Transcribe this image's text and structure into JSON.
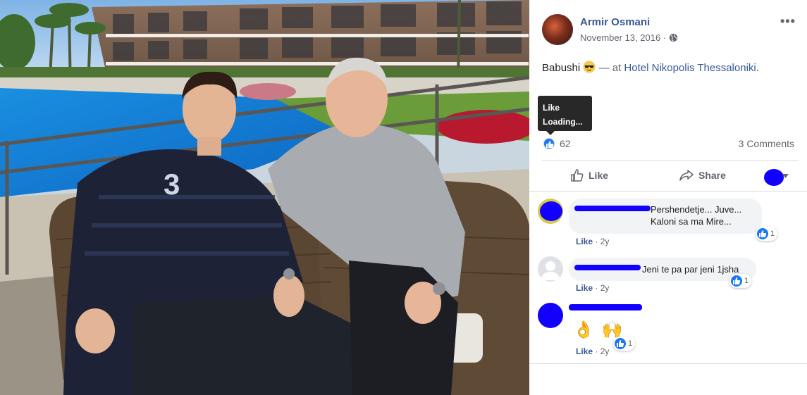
{
  "post": {
    "author": "Armir Osmani",
    "date": "November 13, 2016 ·",
    "caption_text": "Babushi",
    "caption_at": "— at",
    "location": "Hotel Nikopolis Thessaloniki.",
    "menu_glyph": "•••"
  },
  "tooltip": {
    "title": "Like",
    "subtitle": "Loading..."
  },
  "reactions": {
    "count": "62",
    "comments_label": "3 Comments"
  },
  "actions": {
    "like_label": "Like",
    "share_label": "Share"
  },
  "comments": [
    {
      "text": "Pershendetje... Juve... Kaloni sa ma Mire...",
      "like_label": "Like",
      "age": "· 2y",
      "reactions": "1"
    },
    {
      "text": "Jeni te pa par jeni 1jsha",
      "like_label": "Like",
      "age": "· 2y",
      "reactions": "1"
    },
    {
      "text": "👌 🙌",
      "like_label": "Like",
      "age": "· 2y",
      "reactions": "1"
    }
  ],
  "colors": {
    "link": "#385898",
    "facebook_blue": "#1877f2",
    "redaction": "#1200ff"
  }
}
